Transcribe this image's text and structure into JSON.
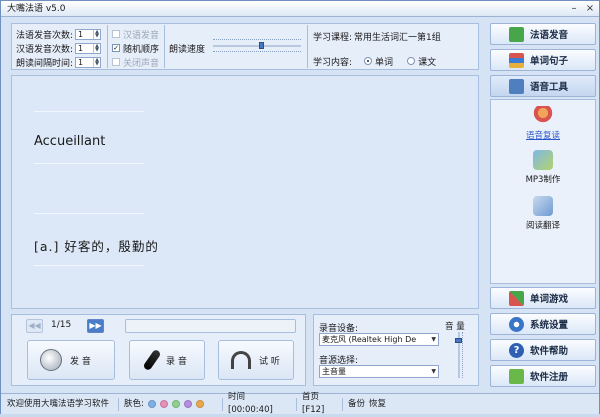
{
  "window": {
    "title": "大嘴法语 v5.0"
  },
  "settings": {
    "fr_count_label": "法语发音次数:",
    "fr_count_value": "1",
    "cn_count_label": "汉语发音次数:",
    "cn_count_value": "1",
    "interval_label": "朗读间隔时间:",
    "interval_value": "1",
    "cn_voice": "汉语发音",
    "random_order": "随机顺序",
    "mute": "关闭声音",
    "speed_label": "朗读速度",
    "speed": 0.55
  },
  "course": {
    "label": "学习课程:",
    "name": "常用生活词汇一第1组",
    "content_label": "学习内容:",
    "opt_word": "单词",
    "opt_text": "课文"
  },
  "display": {
    "word": "Accueillant",
    "meaning": "[a.]  好客的，殷勤的"
  },
  "player": {
    "page": "1/15"
  },
  "actions": {
    "speak": "发 音",
    "record": "录 音",
    "listen": "试 听"
  },
  "audio": {
    "device_label": "录音设备:",
    "device_value": "麦克风 (Realtek High De",
    "volume_label": "音 量",
    "source_label": "音源选择:",
    "source_value": "主音量",
    "volume": 0.85
  },
  "nav": {
    "pronounce": "法语发音",
    "sentences": "单词句子",
    "tools": "语音工具",
    "game": "单词游戏",
    "settings": "系统设置",
    "help": "软件帮助",
    "register": "软件注册"
  },
  "tools": {
    "repeat": "语音复读",
    "mp3": "MP3制作",
    "translate": "阅读翻译"
  },
  "status": {
    "welcome": "欢迎使用大嘴法语学习软件",
    "skin": "肤色:",
    "time": "时间 [00:00:40]",
    "home": "首页[F12]",
    "backup": "备份",
    "restore": "恢复"
  },
  "colors": {
    "accent": "#3a6fb8",
    "skins": [
      "#7eb1e6",
      "#e58fb9",
      "#8fd08f",
      "#b58fdd",
      "#e8a94a"
    ]
  }
}
